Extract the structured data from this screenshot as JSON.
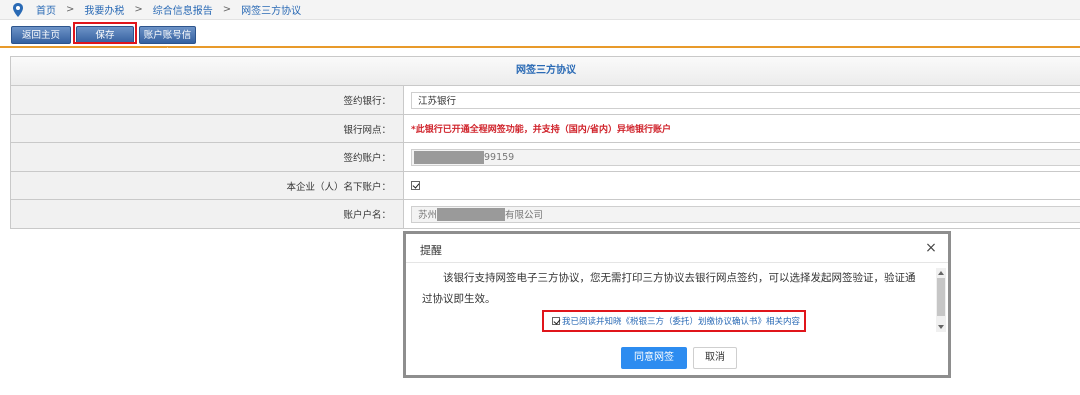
{
  "breadcrumb": {
    "items": [
      "首页",
      "我要办税",
      "综合信息报告",
      "网签三方协议"
    ],
    "separator": ">"
  },
  "toolbar": {
    "back_label": "返回主页",
    "save_label": "保存",
    "account_info_label": "账户账号信息"
  },
  "form": {
    "title": "网签三方协议",
    "rows": {
      "bank": {
        "label": "签约银行：",
        "value": "江苏银行"
      },
      "branch": {
        "label": "银行网点：",
        "value": "*此银行已开通全程网签功能，并支持（国内/省内）异地银行账户"
      },
      "account": {
        "label": "签约账户：",
        "value_suffix": "99159"
      },
      "own_account": {
        "label": "本企业（人）名下账户：",
        "checked": true
      },
      "account_name": {
        "label": "账户户名：",
        "value_prefix": "苏州",
        "value_suffix": "有限公司"
      }
    }
  },
  "dialog": {
    "title": "提醒",
    "close_symbol": "×",
    "message": "该银行支持网签电子三方协议，您无需打印三方协议去银行网点签约，可以选择发起网签验证，验证通过协议即生效。",
    "agree_text": "我已阅读并知晓《税银三方（委托）划缴协议确认书》相关内容",
    "agree_checked": true,
    "confirm_label": "同意网签",
    "cancel_label": "取消"
  },
  "colors": {
    "link_blue": "#2a6ab5",
    "toolbar_orange": "#e89a2a",
    "warning_red": "#d0242c",
    "highlight_red": "#e0151b",
    "primary_button": "#2d8cf0"
  }
}
